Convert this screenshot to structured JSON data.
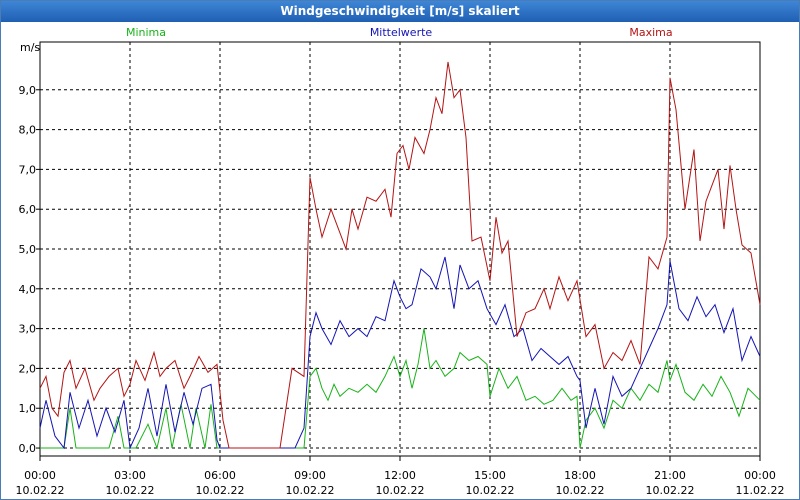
{
  "chart_data": {
    "type": "line",
    "title": "Windgeschwindigkeit [m/s] skaliert",
    "ylabel": "m/s",
    "ylim": [
      -0.2,
      10.2
    ],
    "xlim": [
      0,
      24
    ],
    "yticks": [
      "0,0",
      "1,0",
      "2,0",
      "3,0",
      "4,0",
      "5,0",
      "6,0",
      "7,0",
      "8,0",
      "9,0"
    ],
    "xticks": [
      {
        "time": "00:00",
        "date": "10.02.22"
      },
      {
        "time": "03:00",
        "date": "10.02.22"
      },
      {
        "time": "06:00",
        "date": "10.02.22"
      },
      {
        "time": "09:00",
        "date": "10.02.22"
      },
      {
        "time": "12:00",
        "date": "10.02.22"
      },
      {
        "time": "15:00",
        "date": "10.02.22"
      },
      {
        "time": "18:00",
        "date": "10.02.22"
      },
      {
        "time": "21:00",
        "date": "10.02.22"
      },
      {
        "time": "00:00",
        "date": "11.02.22"
      }
    ],
    "grid": true,
    "legend_position": "top",
    "series": [
      {
        "name": "Minima",
        "color": "#19b319",
        "x": [
          0,
          0.5,
          0.8,
          1,
          1.2,
          1.5,
          2,
          2.3,
          2.6,
          2.8,
          3,
          3.2,
          3.6,
          3.9,
          4.2,
          4.4,
          4.7,
          5,
          5.2,
          5.5,
          5.7,
          5.9,
          6,
          6.2,
          6.5,
          7,
          7.5,
          8,
          8.5,
          8.8,
          9,
          9.2,
          9.4,
          9.6,
          9.8,
          10,
          10.3,
          10.6,
          10.9,
          11.2,
          11.5,
          11.8,
          12,
          12.2,
          12.4,
          12.6,
          12.8,
          13,
          13.2,
          13.5,
          13.8,
          14,
          14.3,
          14.6,
          14.9,
          15,
          15.3,
          15.6,
          15.9,
          16.2,
          16.5,
          16.8,
          17.1,
          17.4,
          17.7,
          17.9,
          18,
          18.2,
          18.5,
          18.8,
          19.1,
          19.4,
          19.7,
          20,
          20.3,
          20.6,
          20.9,
          21,
          21.2,
          21.5,
          21.8,
          22.1,
          22.4,
          22.7,
          23,
          23.3,
          23.6,
          24
        ],
        "values": [
          0,
          0,
          0,
          1,
          0,
          0,
          0,
          0,
          0.8,
          0,
          0,
          0,
          0.6,
          0,
          1,
          0,
          1.1,
          0,
          1,
          0,
          1.1,
          0,
          0,
          0,
          0,
          0,
          0,
          0,
          0,
          0,
          1.8,
          2,
          1.5,
          1.2,
          1.6,
          1.3,
          1.5,
          1.4,
          1.6,
          1.4,
          1.8,
          2.3,
          1.8,
          2.2,
          1.5,
          2.1,
          3,
          2,
          2.2,
          1.8,
          2,
          2.4,
          2.2,
          2.3,
          2.1,
          1.3,
          2,
          1.5,
          1.8,
          1.2,
          1.3,
          1.1,
          1.2,
          1.5,
          1.2,
          1.3,
          0,
          0.7,
          1,
          0.5,
          1.2,
          1,
          1.5,
          1.2,
          1.6,
          1.4,
          2.2,
          1.7,
          2.1,
          1.4,
          1.2,
          1.6,
          1.3,
          1.8,
          1.4,
          0.8,
          1.5,
          1.2
        ]
      },
      {
        "name": "Mittelwerte",
        "color": "#1414b4",
        "x": [
          0,
          0.2,
          0.5,
          0.8,
          1,
          1.3,
          1.6,
          1.9,
          2.2,
          2.5,
          2.8,
          3,
          3.3,
          3.6,
          3.9,
          4.2,
          4.5,
          4.8,
          5.1,
          5.4,
          5.7,
          5.9,
          6,
          6.3,
          6.6,
          7,
          7.5,
          8,
          8.5,
          8.8,
          9,
          9.2,
          9.4,
          9.7,
          10,
          10.3,
          10.6,
          10.9,
          11.2,
          11.5,
          11.8,
          12,
          12.2,
          12.4,
          12.7,
          13,
          13.2,
          13.5,
          13.8,
          14,
          14.3,
          14.6,
          14.9,
          15.2,
          15.5,
          15.8,
          16.1,
          16.4,
          16.7,
          17,
          17.3,
          17.6,
          17.9,
          18,
          18.2,
          18.5,
          18.8,
          19.1,
          19.4,
          19.7,
          20,
          20.3,
          20.6,
          20.9,
          21,
          21.3,
          21.6,
          21.9,
          22.2,
          22.5,
          22.8,
          23.1,
          23.4,
          23.7,
          24
        ],
        "values": [
          0.5,
          1.2,
          0.3,
          0,
          1.4,
          0.5,
          1.2,
          0.3,
          1,
          0.4,
          1.2,
          0,
          0.5,
          1.5,
          0.3,
          1.6,
          0.4,
          1.4,
          0.6,
          1.5,
          1.6,
          0.2,
          0,
          0,
          0,
          0,
          0,
          0,
          0,
          0.5,
          2.8,
          3.4,
          3,
          2.6,
          3.2,
          2.8,
          3,
          2.8,
          3.3,
          3.2,
          4.2,
          3.8,
          3.5,
          3.6,
          4.5,
          4.3,
          4,
          4.8,
          3.5,
          4.6,
          4,
          4.2,
          3.5,
          3.1,
          3.6,
          2.8,
          3,
          2.2,
          2.5,
          2.3,
          2.1,
          2.3,
          1.8,
          1.7,
          0.5,
          1.5,
          0.6,
          1.8,
          1.3,
          1.5,
          2,
          2.5,
          3,
          3.6,
          4.7,
          3.5,
          3.2,
          3.8,
          3.3,
          3.6,
          2.9,
          3.5,
          2.2,
          2.8,
          2.3
        ]
      },
      {
        "name": "Maxima",
        "color": "#b41414",
        "x": [
          0,
          0.2,
          0.4,
          0.6,
          0.8,
          1,
          1.2,
          1.5,
          1.8,
          2,
          2.3,
          2.6,
          2.8,
          3,
          3.2,
          3.5,
          3.8,
          4,
          4.2,
          4.5,
          4.8,
          5,
          5.3,
          5.6,
          5.9,
          6.1,
          6.3,
          6.5,
          7,
          7.5,
          8,
          8.4,
          8.8,
          9,
          9.2,
          9.4,
          9.7,
          10,
          10.2,
          10.4,
          10.6,
          10.9,
          11.2,
          11.5,
          11.7,
          11.9,
          12.1,
          12.3,
          12.5,
          12.8,
          13,
          13.2,
          13.4,
          13.6,
          13.8,
          14,
          14.2,
          14.4,
          14.7,
          15,
          15.2,
          15.4,
          15.6,
          15.9,
          16.2,
          16.5,
          16.8,
          17,
          17.3,
          17.6,
          17.9,
          18.2,
          18.5,
          18.8,
          19.1,
          19.4,
          19.7,
          20,
          20.3,
          20.6,
          20.9,
          21,
          21.2,
          21.5,
          21.8,
          22,
          22.2,
          22.4,
          22.6,
          22.8,
          23,
          23.2,
          23.4,
          23.7,
          24
        ],
        "values": [
          1.5,
          1.8,
          1,
          0.8,
          1.9,
          2.2,
          1.5,
          2,
          1.2,
          1.5,
          1.8,
          2,
          1.3,
          1.6,
          2.2,
          1.7,
          2.4,
          1.8,
          2,
          2.2,
          1.5,
          1.8,
          2.3,
          1.9,
          2.1,
          0.7,
          0,
          0,
          0,
          0,
          0,
          2,
          1.8,
          6.8,
          6,
          5.3,
          6,
          5.4,
          5,
          6,
          5.5,
          6.3,
          6.2,
          6.5,
          5.8,
          7.4,
          7.6,
          7,
          7.8,
          7.4,
          8,
          8.8,
          8.4,
          9.7,
          8.8,
          9,
          7.8,
          5.2,
          5.3,
          4.2,
          5.8,
          4.9,
          5.2,
          2.8,
          3.4,
          3.5,
          4,
          3.5,
          4.3,
          3.7,
          4.2,
          2.8,
          3.1,
          2,
          2.4,
          2.2,
          2.7,
          2.1,
          4.8,
          4.5,
          5.3,
          9.3,
          8.5,
          6,
          7.5,
          5.2,
          6.2,
          6.6,
          7,
          5.5,
          7.1,
          6,
          5.1,
          4.9,
          3.6
        ]
      }
    ]
  }
}
